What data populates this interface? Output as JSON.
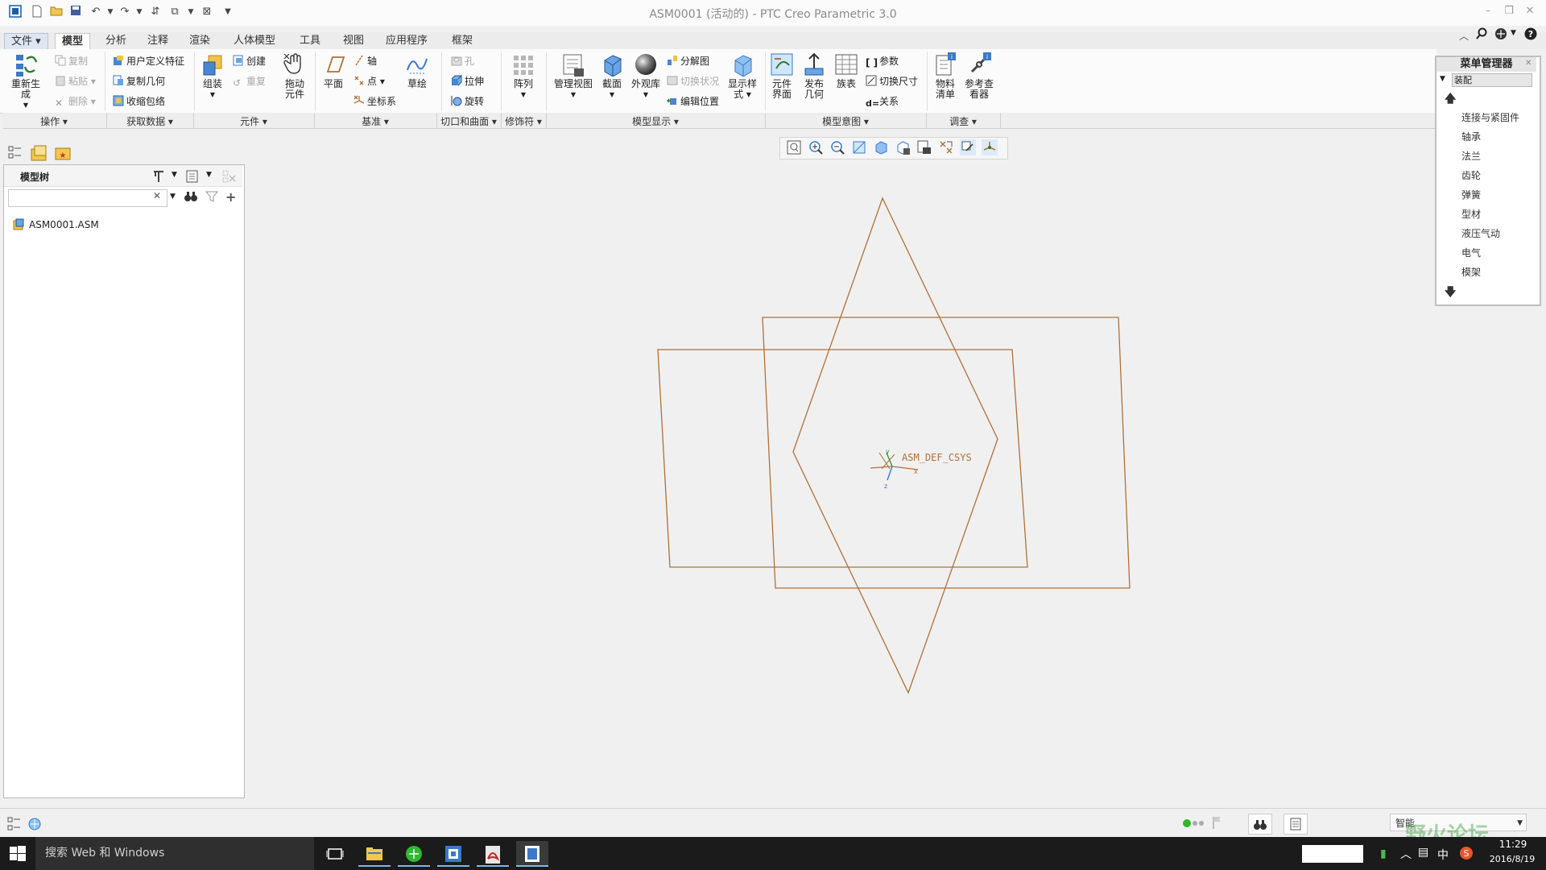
{
  "app": {
    "title": "ASM0001 (活动的) - PTC Creo Parametric 3.0"
  },
  "tabs": [
    "文件",
    "模型",
    "分析",
    "注释",
    "渲染",
    "人体模型",
    "工具",
    "视图",
    "应用程序",
    "框架"
  ],
  "active_tab": "模型",
  "ribbon": {
    "regen": "重新生成",
    "copy": "复制",
    "paste": "粘贴",
    "delete": "删除",
    "udf": "用户定义特征",
    "copy_geom": "复制几何",
    "shrinkwrap": "收缩包络",
    "assemble": "组装",
    "create": "创建",
    "repeat": "重复",
    "drag_line1": "拖动",
    "drag_line2": "元件",
    "plane": "平面",
    "axis": "轴",
    "point": "点",
    "csys": "坐标系",
    "sketch": "草绘",
    "hole": "孔",
    "extrude": "拉伸",
    "revolve": "旋转",
    "pattern": "阵列",
    "manage_views": "管理视图",
    "section": "截面",
    "appearance": "外观库",
    "explode": "分解图",
    "toggle_status": "切换状况",
    "edit_position": "编辑位置",
    "display_style_line1": "显示样",
    "display_style_line2": "式",
    "comp_iface_line1": "元件",
    "comp_iface_line2": "界面",
    "publish_line1": "发布",
    "publish_line2": "几何",
    "family_table": "族表",
    "params": "参数",
    "switch_dims": "切换尺寸",
    "relations": "关系",
    "bom_line1": "物料",
    "bom_line2": "清单",
    "ref_viewer_line1": "参考查",
    "ref_viewer_line2": "看器"
  },
  "groups": [
    "操作",
    "获取数据",
    "元件",
    "基准",
    "切口和曲面",
    "修饰符",
    "模型显示",
    "模型意图",
    "调查"
  ],
  "tree": {
    "header": "模型树",
    "search_placeholder": "",
    "root": "ASM0001.ASM"
  },
  "canvas": {
    "csys_label": "ASM_DEF_CSYS",
    "line_color": "#b07038"
  },
  "menu_manager": {
    "title": "菜单管理器",
    "section": "装配",
    "items": [
      "连接与紧固件",
      "轴承",
      "法兰",
      "齿轮",
      "弹簧",
      "型材",
      "液压气动",
      "电气",
      "模架"
    ]
  },
  "taskbar": {
    "search_placeholder": "搜索 Web 和 Windows",
    "ime": "中",
    "time": "11:29",
    "date": "2016/8/19",
    "status_filter": "智能",
    "watermark": "野火论坛"
  }
}
